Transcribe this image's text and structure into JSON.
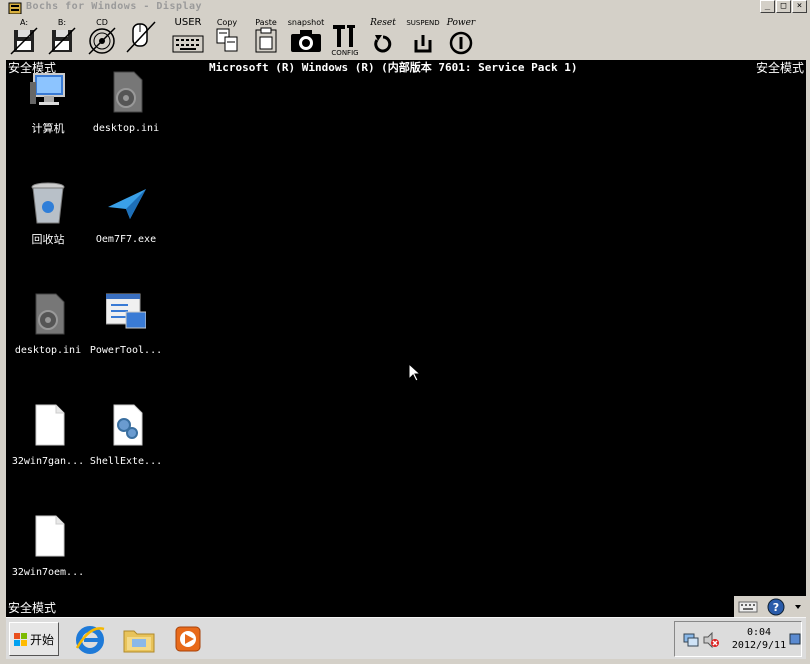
{
  "window": {
    "title": "Bochs for Windows - Display",
    "controls": [
      "_",
      "□",
      "×"
    ]
  },
  "toolbar": {
    "floppy_a_label": "A:",
    "floppy_b_label": "B:",
    "cdrom_label": "CD",
    "user_label": "USER",
    "copy_label": "Copy",
    "paste_label": "Paste",
    "snapshot_label": "snapshot",
    "config_label": "CONFIG",
    "reset_label": "Reset",
    "suspend_label": "SUSPEND",
    "power_label": "Power"
  },
  "screen": {
    "safe_mode_label": "安全模式",
    "banner": "Microsoft (R) Windows (R) (内部版本 7601: Service Pack 1)",
    "desktop_icons": [
      {
        "name": "computer-icon",
        "label": "计算机"
      },
      {
        "name": "desktop-ini-icon",
        "label": "desktop.ini"
      },
      {
        "name": "recycle-bin-icon",
        "label": "回收站"
      },
      {
        "name": "oem-exe-icon",
        "label": "Oem7F7.exe"
      },
      {
        "name": "desktop-ini-icon",
        "label": "desktop.ini"
      },
      {
        "name": "powertool-icon",
        "label": "PowerTool..."
      },
      {
        "name": "file-icon",
        "label": "32win7gan..."
      },
      {
        "name": "shellext-icon",
        "label": "ShellExte..."
      },
      {
        "name": "file-icon",
        "label": "32win7oem..."
      }
    ]
  },
  "taskbar": {
    "start_label": "开始",
    "clock_time": "0:04",
    "clock_date": "2012/9/11"
  },
  "colors": {
    "screen_bg": "#000000",
    "chrome": "#d4d0c8",
    "taskbar": "#dcdcdc"
  }
}
